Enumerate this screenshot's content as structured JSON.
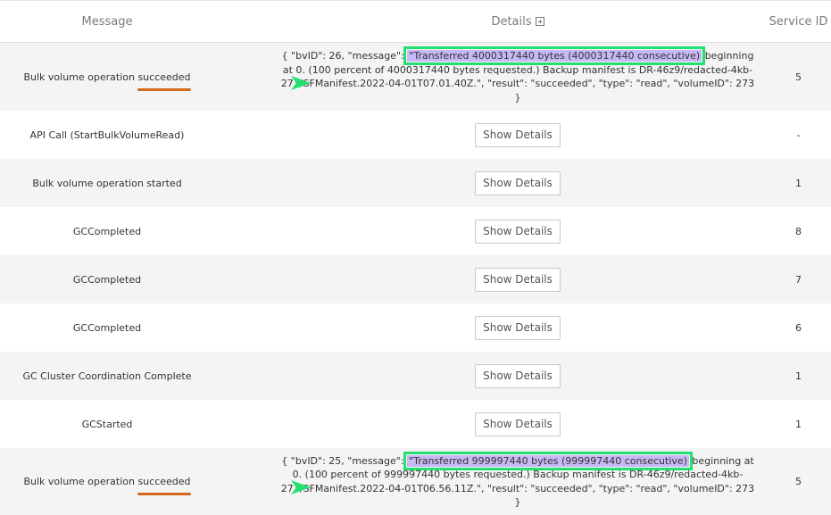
{
  "header": {
    "message": "Message",
    "details": "Details",
    "service_id": "Service ID"
  },
  "buttons": {
    "show_details": "Show Details"
  },
  "rows": [
    {
      "message_pre": "Bulk volume operation ",
      "message_hl": "succeeded",
      "detail_pre": "{ \"bvID\": 26, \"message\": ",
      "detail_hl": "\"Transferred 4000317440 bytes (4000317440 consecutive)",
      "detail_post": " beginning at 0. (100 percent of 4000317440 bytes requested.) Backup manifest is DR-46z9/redacted-4kb-273/SFManifest.2022-04-01T07.01.40Z.\", \"result\": \"succeeded\", \"type\": \"read\", \"volumeID\": 273 }",
      "service_id": "5"
    },
    {
      "message": "API Call (StartBulkVolumeRead)",
      "service_id": "-"
    },
    {
      "message": "Bulk volume operation started",
      "service_id": "1"
    },
    {
      "message": "GCCompleted",
      "service_id": "8"
    },
    {
      "message": "GCCompleted",
      "service_id": "7"
    },
    {
      "message": "GCCompleted",
      "service_id": "6"
    },
    {
      "message": "GC Cluster Coordination Complete",
      "service_id": "1"
    },
    {
      "message": "GCStarted",
      "service_id": "1"
    },
    {
      "message_pre": "Bulk volume operation ",
      "message_hl": "succeeded",
      "detail_pre": "{ \"bvID\": 25, \"message\": ",
      "detail_hl": "\"Transferred 999997440 bytes (999997440 consecutive)",
      "detail_post": " beginning at 0. (100 percent of 999997440 bytes requested.) Backup manifest is DR-46z9/redacted-4kb-273/SFManifest.2022-04-01T06.56.11Z.\", \"result\": \"succeeded\", \"type\": \"read\", \"volumeID\": 273 }",
      "service_id": "5"
    }
  ],
  "colors": {
    "highlight_fill": "#c8b8f5",
    "highlight_border": "#22e06e",
    "underline": "#d2691e",
    "arrow": "#22e06e"
  }
}
